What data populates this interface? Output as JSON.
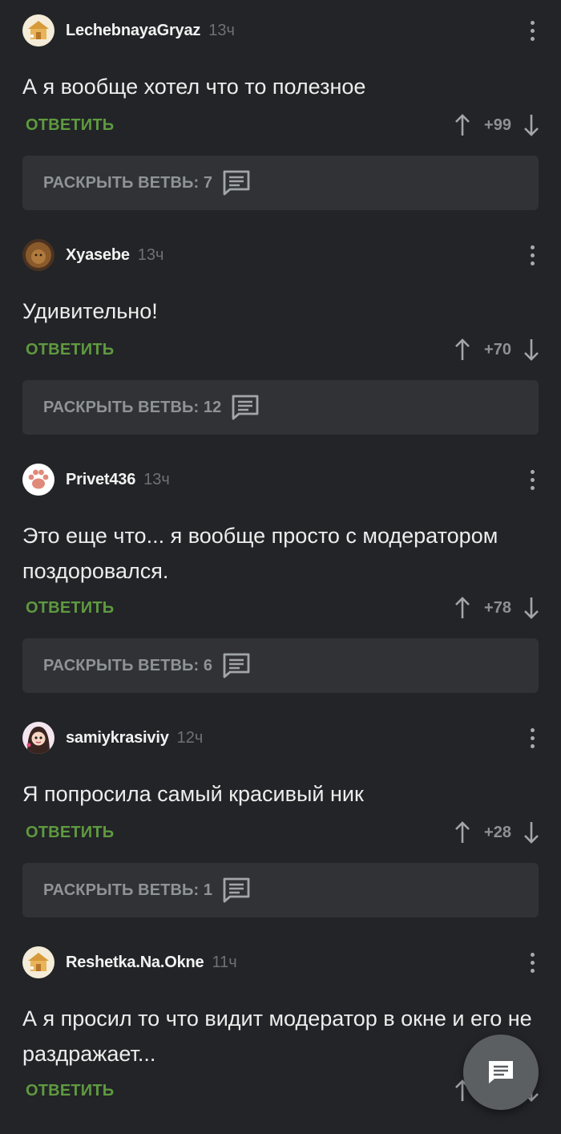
{
  "comments": [
    {
      "user": "LechebnayaGryaz",
      "time": "13ч",
      "text": "А я вообще хотел что то полезное",
      "reply": "ОТВЕТИТЬ",
      "score": "+99",
      "branch": "РАСКРЫТЬ ВЕТВЬ: 7",
      "avatar": "house-avatar"
    },
    {
      "user": "Xyasebe",
      "time": "13ч",
      "text": "Удивительно!",
      "reply": "ОТВЕТИТЬ",
      "score": "+70",
      "branch": "РАСКРЫТЬ ВЕТВЬ: 12",
      "avatar": "lion-avatar"
    },
    {
      "user": "Privet436",
      "time": "13ч",
      "text": "Это еще что... я вообще просто с модератором поздоровался.",
      "reply": "ОТВЕТИТЬ",
      "score": "+78",
      "branch": "РАСКРЫТЬ ВЕТВЬ: 6",
      "avatar": "paw-avatar"
    },
    {
      "user": "samiykrasiviy",
      "time": "12ч",
      "text": "Я попросила самый красивый ник",
      "reply": "ОТВЕТИТЬ",
      "score": "+28",
      "branch": "РАСКРЫТЬ ВЕТВЬ: 1",
      "avatar": "girl-avatar"
    },
    {
      "user": "Reshetka.Na.Okne",
      "time": "11ч",
      "text": "А я просил то что видит модератор в окне и его не раздражает...",
      "reply": "ОТВЕТИТЬ",
      "avatar": "house-avatar"
    }
  ],
  "colors": {
    "background": "#222427",
    "reply": "#5f9a3f",
    "branch_bg": "#303235",
    "fab": "#5c5f62"
  },
  "icons": {
    "upvote": "arrow-up-icon",
    "downvote": "arrow-down-icon",
    "branch": "comment-bubble-icon",
    "more": "more-vertical-icon",
    "fab": "comment-icon"
  }
}
